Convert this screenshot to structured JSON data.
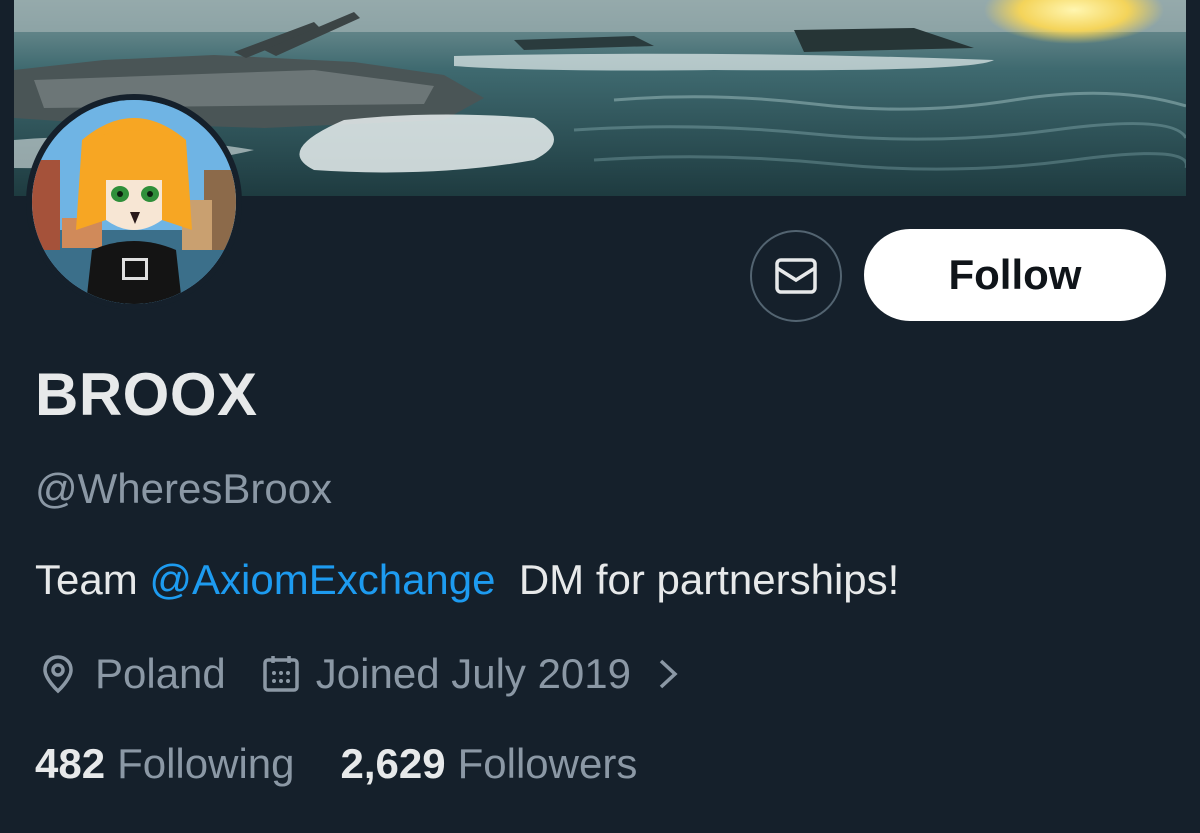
{
  "profile": {
    "display_name": "BROOX",
    "handle": "@WheresBroox",
    "bio": {
      "prefix": "Team ",
      "mention": "@AxiomExchange",
      "suffix": "  DM for partnerships!"
    },
    "location": "Poland",
    "joined": "Joined July 2019",
    "following_count": "482",
    "following_label": "Following",
    "followers_count": "2,629",
    "followers_label": "Followers"
  },
  "actions": {
    "follow_label": "Follow"
  },
  "icons": {
    "message": "envelope-icon",
    "location": "location-pin-icon",
    "calendar": "calendar-icon",
    "chevron": "chevron-right-icon"
  },
  "colors": {
    "background": "#15202b",
    "primary_text": "#e7e9ea",
    "secondary_text": "#8b98a5",
    "link": "#1d9bf0",
    "button_bg": "#ffffff",
    "button_text": "#0f1419"
  }
}
